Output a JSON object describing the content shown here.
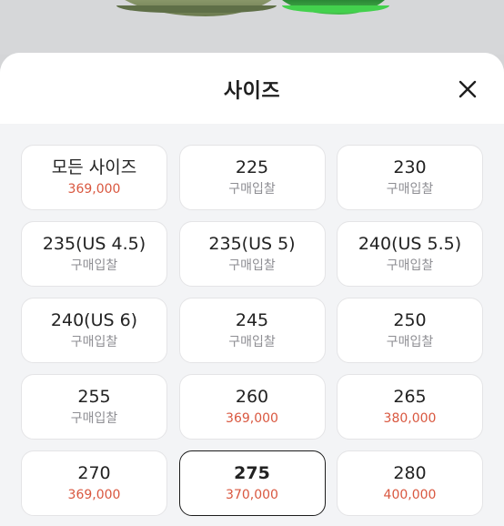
{
  "sheet": {
    "title": "사이즈",
    "close_icon": "close-icon"
  },
  "colors": {
    "price": "#d9573f",
    "muted": "#8e8e93",
    "selected_border": "#1c1c1c"
  },
  "sizes": [
    {
      "size": "모든 사이즈",
      "price": "369,000",
      "kind": "value"
    },
    {
      "size": "225",
      "price": "구매입찰",
      "kind": "bid"
    },
    {
      "size": "230",
      "price": "구매입찰",
      "kind": "bid"
    },
    {
      "size": "235(US 4.5)",
      "price": "구매입찰",
      "kind": "bid"
    },
    {
      "size": "235(US 5)",
      "price": "구매입찰",
      "kind": "bid"
    },
    {
      "size": "240(US 5.5)",
      "price": "구매입찰",
      "kind": "bid"
    },
    {
      "size": "240(US 6)",
      "price": "구매입찰",
      "kind": "bid"
    },
    {
      "size": "245",
      "price": "구매입찰",
      "kind": "bid"
    },
    {
      "size": "250",
      "price": "구매입찰",
      "kind": "bid"
    },
    {
      "size": "255",
      "price": "구매입찰",
      "kind": "bid"
    },
    {
      "size": "260",
      "price": "369,000",
      "kind": "value"
    },
    {
      "size": "265",
      "price": "380,000",
      "kind": "value"
    },
    {
      "size": "270",
      "price": "369,000",
      "kind": "value"
    },
    {
      "size": "275",
      "price": "370,000",
      "kind": "value",
      "selected": true
    },
    {
      "size": "280",
      "price": "400,000",
      "kind": "value"
    }
  ]
}
